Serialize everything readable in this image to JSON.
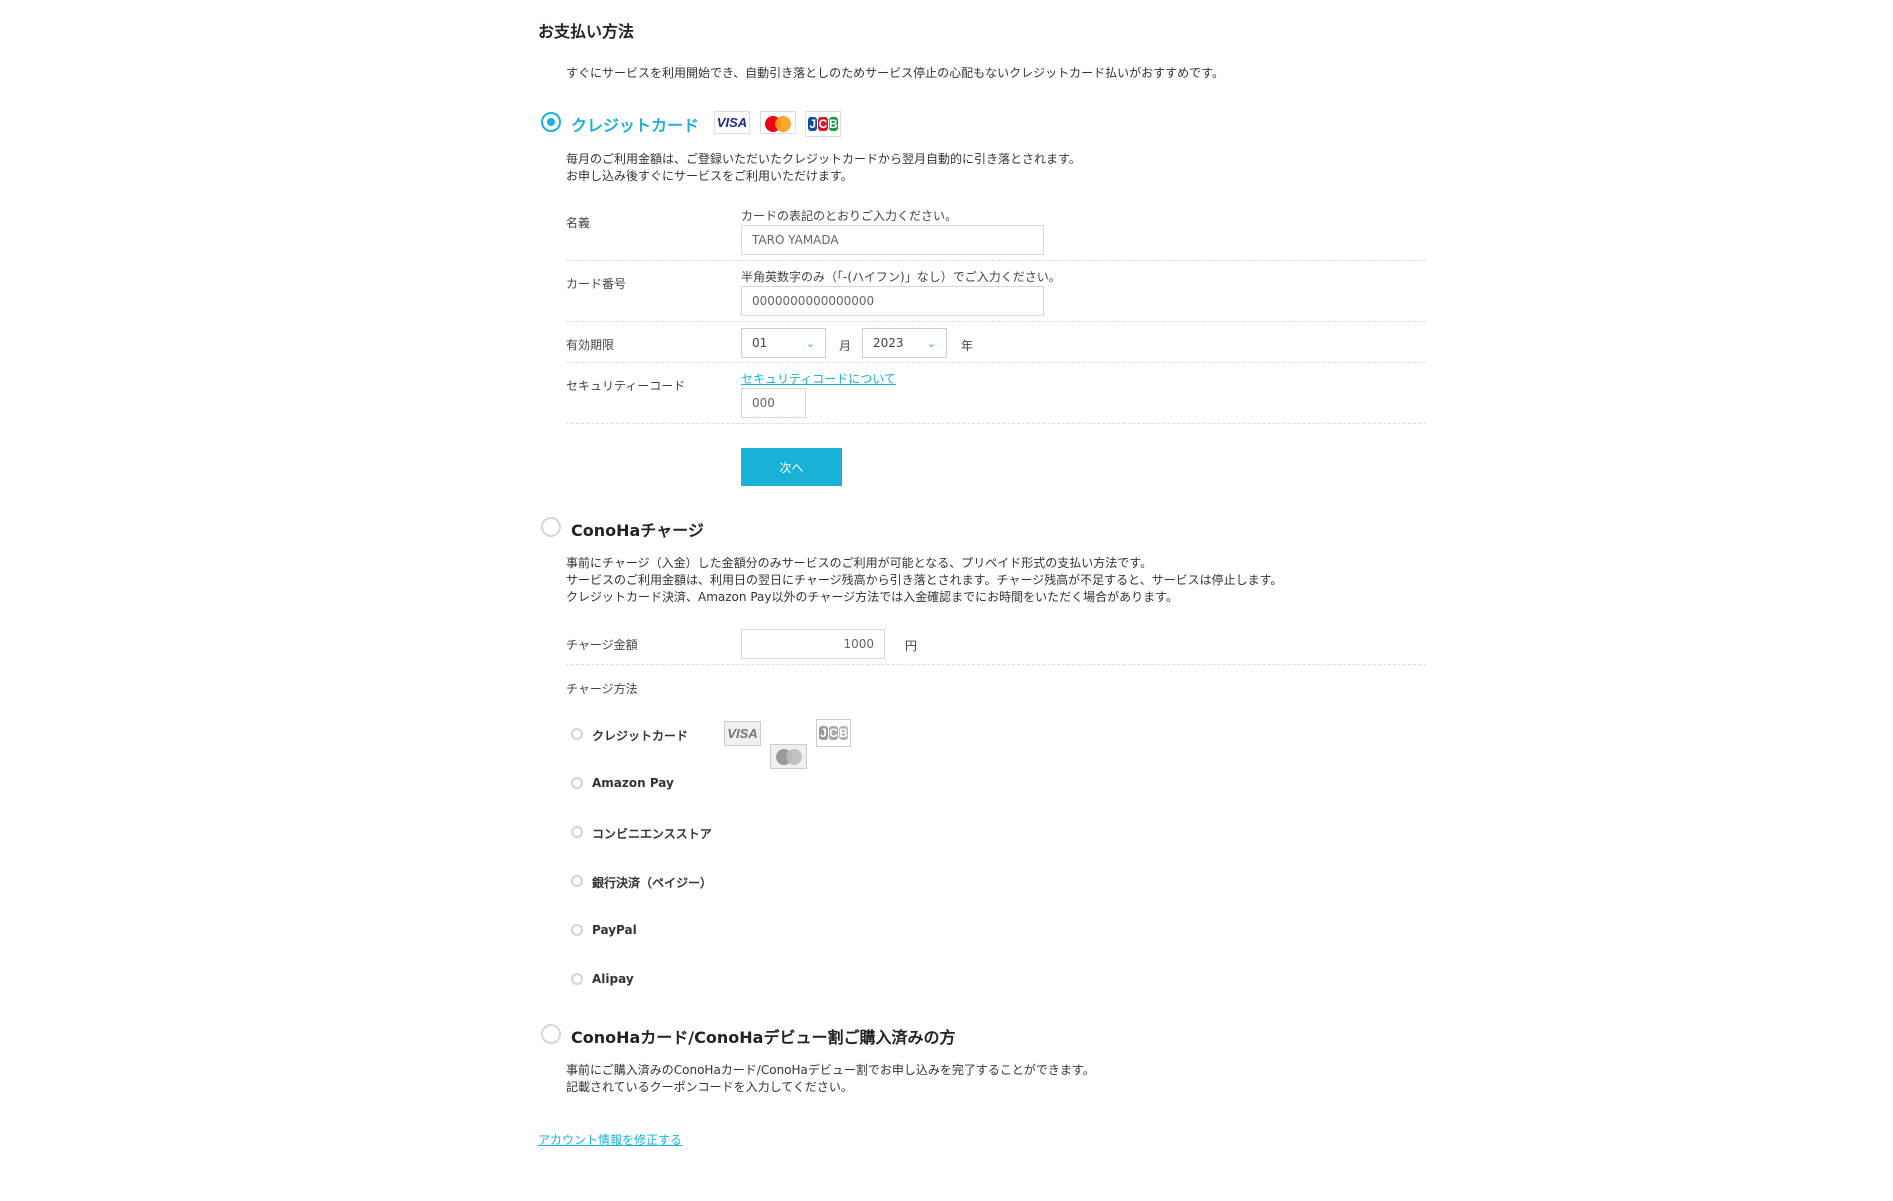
{
  "page": {
    "title": "お支払い方法",
    "intro": "すぐにサービスを利用開始でき、自動引き落としのためサービス停止の心配もないクレジットカード払いがおすすめです。"
  },
  "credit": {
    "title": "クレジットカード",
    "desc": "毎月のご利用金額は、ご登録いただいたクレジットカードから翌月自動的に引き落とされます。\nお申し込み後すぐにサービスをご利用いただけます。",
    "name_label": "名義",
    "name_hint": "カードの表記のとおりご入力ください。",
    "name_placeholder": "TARO YAMADA",
    "number_label": "カード番号",
    "number_hint": "半角英数字のみ（「-(ハイフン)」なし）でご入力ください。",
    "number_placeholder": "0000000000000000",
    "expiry_label": "有効期限",
    "expiry_month": "01",
    "expiry_month_unit": "月",
    "expiry_year": "2023",
    "expiry_year_unit": "年",
    "cvc_label": "セキュリティーコード",
    "cvc_link": "セキュリティコードについて",
    "cvc_placeholder": "000",
    "next_button": "次へ"
  },
  "brands": {
    "visa": "VISA",
    "jcb": [
      "J",
      "C",
      "B"
    ]
  },
  "charge": {
    "title": "ConoHaチャージ",
    "desc": "事前にチャージ（入金）した金額分のみサービスのご利用が可能となる、プリペイド形式の支払い方法です。\nサービスのご利用金額は、利用日の翌日にチャージ残高から引き落とされます。チャージ残高が不足すると、サービスは停止します。\nクレジットカード決済、Amazon Pay以外のチャージ方法では入金確認までにお時間をいただく場合があります。",
    "amount_label": "チャージ金額",
    "amount_value": "1000",
    "amount_unit": "円",
    "method_label": "チャージ方法",
    "methods": [
      "クレジットカード",
      "Amazon Pay",
      "コンビニエンスストア",
      "銀行決済（ペイジー）",
      "PayPal",
      "Alipay"
    ]
  },
  "card_coupon": {
    "title": "ConoHaカード/ConoHaデビュー割ご購入済みの方",
    "desc": "事前にご購入済みのConoHaカード/ConoHaデビュー割でお申し込みを完了することができます。\n記載されているクーポンコードを入力してください。"
  },
  "footer": {
    "edit_account_link": "アカウント情報を修正する"
  },
  "colors": {
    "accent": "#19b1d6",
    "border": "#d8d8d8"
  }
}
